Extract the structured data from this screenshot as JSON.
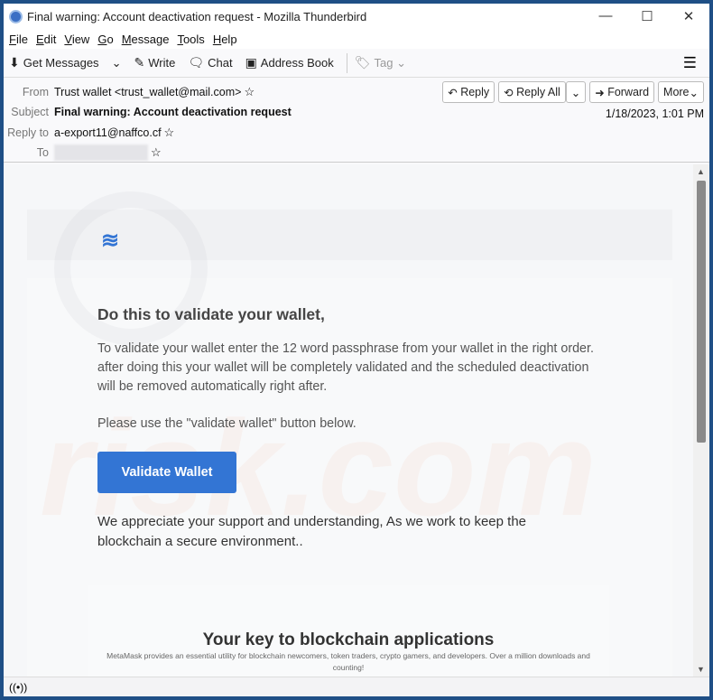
{
  "window": {
    "title": "Final warning: Account deactivation request - Mozilla Thunderbird",
    "minimize": "—",
    "maximize": "☐",
    "close": "✕"
  },
  "menu": [
    "File",
    "Edit",
    "View",
    "Go",
    "Message",
    "Tools",
    "Help"
  ],
  "toolbar": {
    "get_messages": "Get Messages",
    "write": "Write",
    "chat": "Chat",
    "address_book": "Address Book",
    "tag": "Tag"
  },
  "header": {
    "from_label": "From",
    "from": "Trust wallet <trust_wallet@mail.com>",
    "subject_label": "Subject",
    "subject": "Final warning: Account deactivation request",
    "reply_to_label": "Reply to",
    "reply_to": "a-export11@naffco.cf",
    "to_label": "To",
    "date": "1/18/2023, 1:01 PM",
    "reply": "Reply",
    "reply_all": "Reply All",
    "forward": "Forward",
    "more": "More"
  },
  "email": {
    "heading": "Do this to validate your wallet,",
    "para1": "To validate your wallet enter the 12 word passphrase from your wallet in the right order. after doing this your wallet will be completely validated and the scheduled deactivation will be removed automatically right after.",
    "para2": "Please use the \"validate wallet\" button below.",
    "button": "Validate Wallet",
    "para3": "We appreciate your support and understanding, As we work to keep the blockchain a secure environment..",
    "promo_title": "Your key to blockchain applications",
    "promo_text": "MetaMask provides an essential utility for blockchain newcomers, token traders, crypto gamers, and developers. Over a million downloads and counting!"
  },
  "watermark": "risk.com",
  "colors": {
    "accent": "#3375d4",
    "frame": "#1f4f86"
  }
}
